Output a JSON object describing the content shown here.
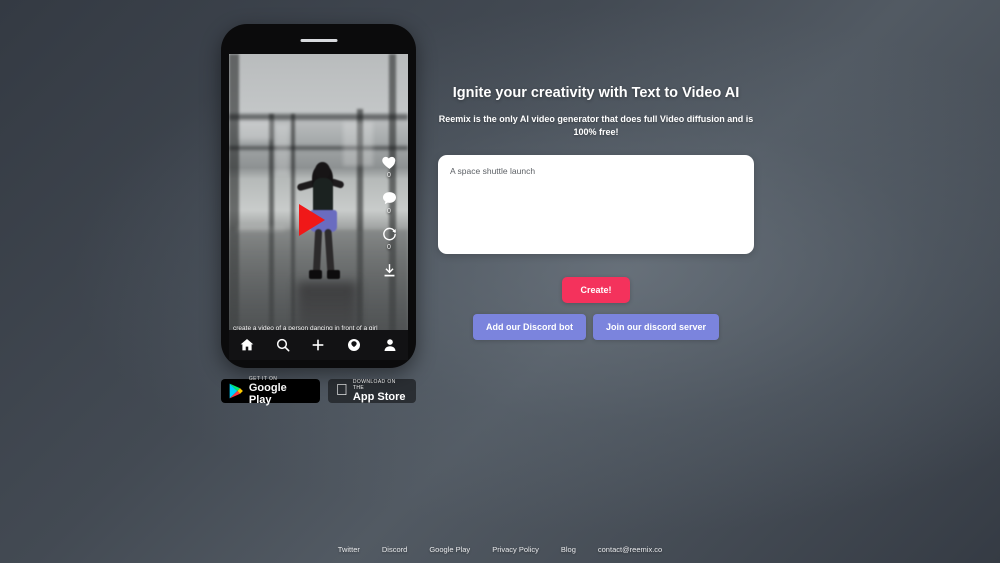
{
  "hero": {
    "headline": "Ignite your creativity with Text to Video AI",
    "subhead": "Reemix is the only AI video generator that does full Video diffusion and is 100% free!",
    "prompt_value": "A space shuttle launch",
    "prompt_placeholder": "A space shuttle launch",
    "create_label": "Create!",
    "discord_bot_label": "Add our Discord bot",
    "discord_server_label": "Join our discord server"
  },
  "phone": {
    "video_caption": "create a video of a person dancing in front of a girl",
    "actions": [
      {
        "icon": "heart-icon",
        "count": "0"
      },
      {
        "icon": "comment-icon",
        "count": "0"
      },
      {
        "icon": "remix-icon",
        "count": "0"
      },
      {
        "icon": "download-icon",
        "count": ""
      }
    ],
    "nav": [
      {
        "icon": "home-icon"
      },
      {
        "icon": "search-icon"
      },
      {
        "icon": "plus-icon"
      },
      {
        "icon": "activity-icon"
      },
      {
        "icon": "profile-icon"
      }
    ]
  },
  "badges": {
    "google_play": {
      "top": "GET IT ON",
      "main": "Google Play"
    },
    "app_store": {
      "top": "Download on the",
      "main": "App Store"
    }
  },
  "footer": {
    "links": [
      "Twitter",
      "Discord",
      "Google Play",
      "Privacy Policy",
      "Blog",
      "contact@reemix.co"
    ]
  },
  "colors": {
    "create_button": "#f4325c",
    "discord_button": "#7b84dd",
    "play_triangle": "#f01818",
    "background_dark": "#343a43",
    "background_light": "#565e66"
  }
}
